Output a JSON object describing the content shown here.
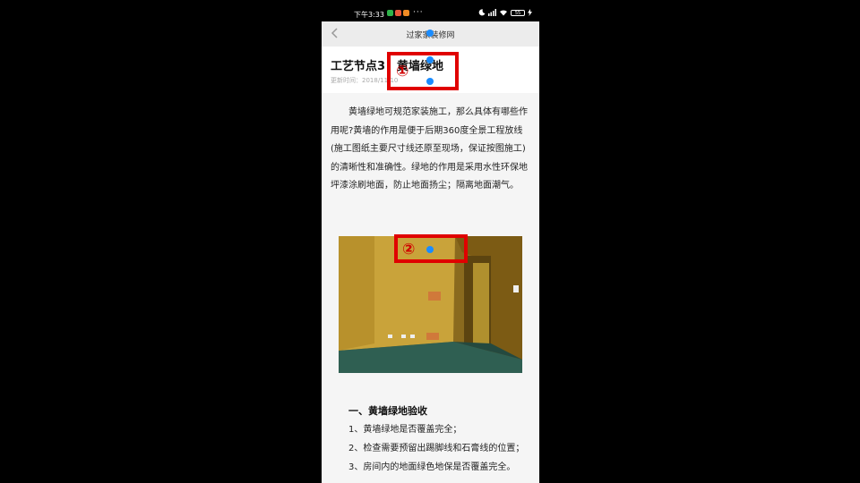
{
  "statusbar": {
    "time": "下午3:33",
    "battery": "55"
  },
  "navbar": {
    "title": "过家家装修网"
  },
  "article": {
    "title": "工艺节点3：黄墙绿地",
    "meta": "更新时间：2018/11/10",
    "body": "黄墙绿地可规范家装施工，那么具体有哪些作用呢?黄墙的作用是便于后期360度全景工程放线(施工图纸主要尺寸线还原至现场，保证按图施工)的清晰性和准确性。绿地的作用是采用水性环保地坪漆涂刷地面，防止地面扬尘；隔离地面潮气。",
    "section_title": "一、黄墙绿地验收",
    "checklist": [
      "1、黄墙绿地是否覆盖完全；",
      "2、检查需要预留出踢脚线和石膏线的位置；",
      "3、房间内的地面绿色地保是否覆盖完全。"
    ]
  },
  "annotations": {
    "box1_label": "①",
    "box2_label": "②",
    "color": "#e00000",
    "dot_color": "#1a8cff"
  }
}
